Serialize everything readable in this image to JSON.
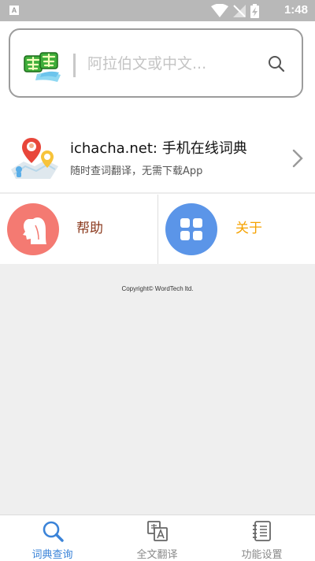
{
  "status_bar": {
    "notification_letter": "A",
    "time": "1:48"
  },
  "search": {
    "placeholder": "阿拉伯文或中文...",
    "value": ""
  },
  "promo": {
    "title": "ichacha.net: 手机在线词典",
    "subtitle": "随时查词翻译，无需下载App"
  },
  "tiles": {
    "help_label": "帮助",
    "about_label": "关于"
  },
  "footer": {
    "copyright": "Copyright© WordTech ltd."
  },
  "bottom_nav": {
    "items": [
      {
        "label": "词典查询",
        "icon": "search-icon",
        "active": true
      },
      {
        "label": "全文翻译",
        "icon": "translate-icon",
        "active": false
      },
      {
        "label": "功能设置",
        "icon": "notebook-icon",
        "active": false
      }
    ]
  },
  "colors": {
    "accent_blue": "#3a83d8",
    "help_circle": "#f47a72",
    "about_circle": "#5b95e8",
    "help_label": "#8b3a1e",
    "about_label": "#f5a200"
  }
}
